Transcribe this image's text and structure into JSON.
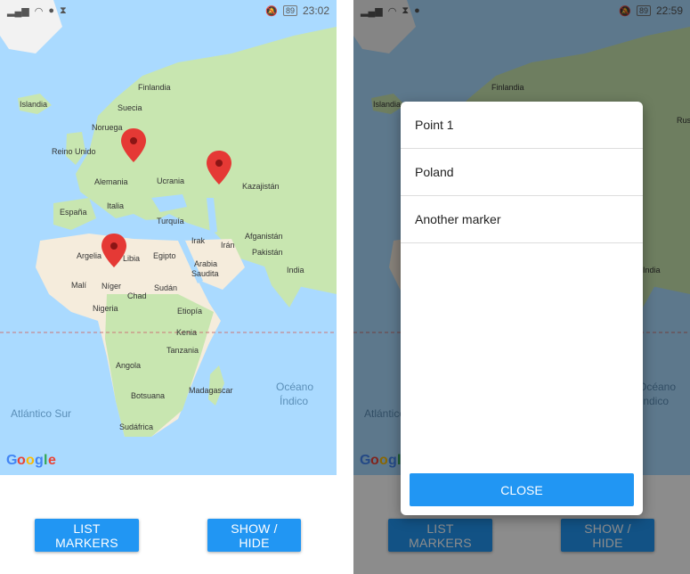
{
  "left_screen": {
    "status": {
      "left_icons": [
        "signal-icon",
        "wifi-icon",
        "app-icon",
        "hourglass-icon"
      ],
      "time": "23:02",
      "battery": "89"
    },
    "map": {
      "labels": {
        "islandia": "Islandia",
        "finlandia": "Finlandia",
        "suecia": "Suecia",
        "noruega": "Noruega",
        "reino_unido": "Reino Unido",
        "alemania": "Alemania",
        "ucrania": "Ucrania",
        "kazajistan": "Kazajistán",
        "espana": "España",
        "italia": "Italia",
        "turquia": "Turquía",
        "afganistan": "Afganistán",
        "irak": "Irak",
        "iran": "Irán",
        "pakistan": "Pakistán",
        "argelia": "Argelia",
        "libia": "Libia",
        "egipto": "Egipto",
        "arabia_saudita_1": "Arabia",
        "arabia_saudita_2": "Saudita",
        "india": "India",
        "mali": "Malí",
        "niger": "Níger",
        "chad": "Chad",
        "sudan": "Sudán",
        "nigeria": "Nigeria",
        "etiopia": "Etiopía",
        "kenia": "Kenia",
        "tanzania": "Tanzania",
        "angola": "Angola",
        "botsuana": "Botsuana",
        "madagascar": "Madagascar",
        "sudafrica": "Sudáfrica",
        "oceano_1": "Océano",
        "oceano_2": "Índico",
        "atlantico_sur": "Atlántico Sur",
        "rus": "Rus"
      },
      "google": [
        "G",
        "o",
        "o",
        "g",
        "l",
        "e"
      ]
    },
    "buttons": {
      "list_markers": "LIST MARKERS",
      "show_hide": "SHOW / HIDE"
    }
  },
  "right_screen": {
    "status": {
      "left_icons": [
        "signal-icon",
        "wifi-icon",
        "hourglass-icon",
        "app-icon"
      ],
      "time": "22:59",
      "battery": "89"
    },
    "dialog": {
      "items": [
        "Point 1",
        "Poland",
        "Another marker"
      ],
      "close_label": "CLOSE"
    },
    "buttons": {
      "list_markers": "LIST MARKERS",
      "show_hide": "SHOW / HIDE"
    }
  },
  "colors": {
    "water": "#aadaff",
    "land": "#c8e6b0",
    "desert": "#f5ecdc",
    "accent": "#2196F3",
    "marker": "#e53935"
  }
}
